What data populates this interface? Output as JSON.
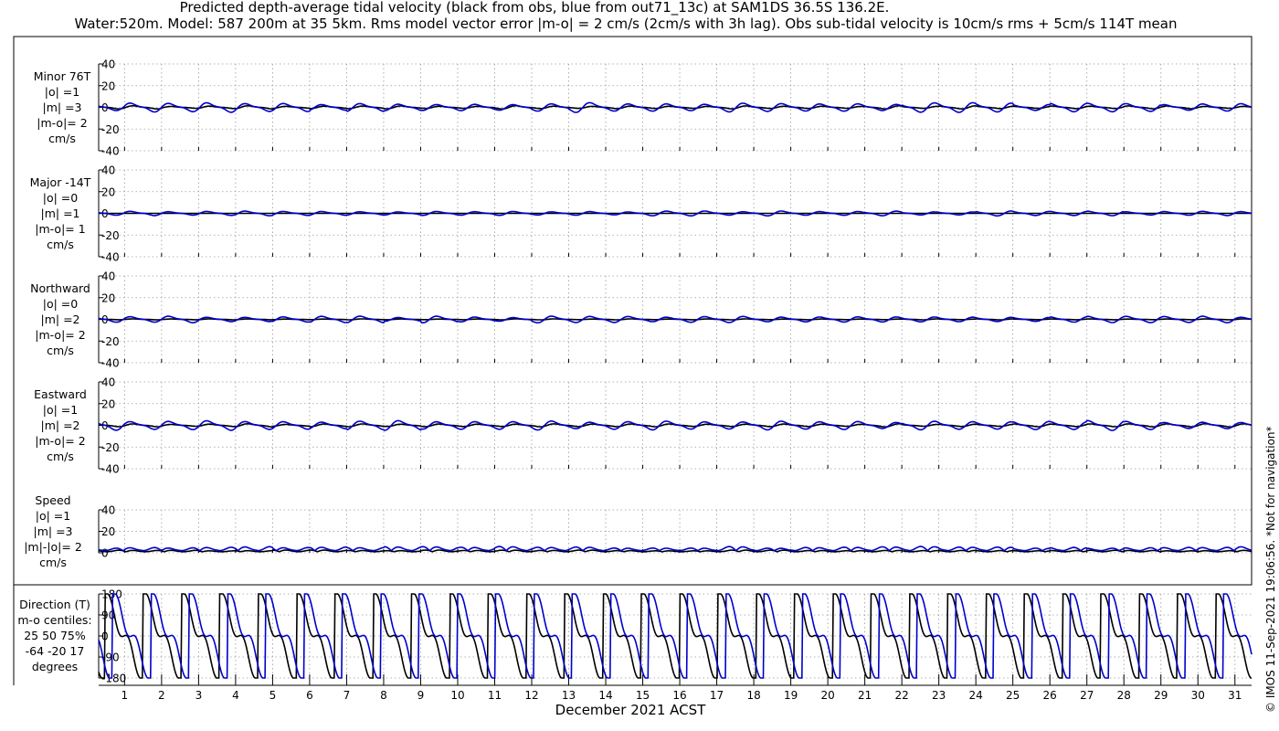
{
  "header": {
    "title_line1": "Predicted depth-average tidal velocity (black from obs, blue from out71_13c) at SAM1DS 36.5S 136.2E.",
    "title_line2": "Water:520m. Model: 587 200m at 35 5km. Rms model vector error |m-o| = 2 cm/s (2cm/s with 3h lag). Obs sub-tidal velocity is 10cm/s rms + 5cm/s 114T mean"
  },
  "footer": {
    "xlabel": "December 2021 ACST",
    "copyright": "© IMOS 11-Sep-2021 19:06:56. *Not for navigation*"
  },
  "colors": {
    "obs": "#000000",
    "model": "#0000cc",
    "grid": "#9a9a9a"
  },
  "panels": [
    {
      "id": "minor",
      "label_lines": [
        "Minor 76T",
        "|o| =1",
        "|m| =3",
        "|m-o|= 2",
        "cm/s"
      ]
    },
    {
      "id": "major",
      "label_lines": [
        "Major -14T",
        "|o| =0",
        "|m| =1",
        "|m-o|= 1",
        "cm/s"
      ]
    },
    {
      "id": "north",
      "label_lines": [
        "Northward",
        "|o| =0",
        "|m| =2",
        "|m-o|= 2",
        "cm/s"
      ]
    },
    {
      "id": "east",
      "label_lines": [
        "Eastward",
        "|o| =1",
        "|m| =2",
        "|m-o|= 2",
        "cm/s"
      ]
    },
    {
      "id": "speed",
      "label_lines": [
        "Speed",
        "|o| =1",
        "|m| =3",
        "|m|-|o|= 2",
        "cm/s"
      ]
    },
    {
      "id": "direction",
      "label_lines": [
        "Direction (T)",
        "m-o centiles:",
        "25  50  75%",
        "-64 -20  17",
        "degrees"
      ]
    }
  ],
  "chart_data": [
    {
      "id": "minor",
      "type": "line",
      "ylabel": "Minor 76T (cm/s)",
      "ylim": [
        -40,
        40
      ],
      "yticks": [
        -40,
        -20,
        0,
        20,
        40
      ],
      "xlim": [
        0.3,
        31.45
      ],
      "xticks": [
        1,
        2,
        3,
        4,
        5,
        6,
        7,
        8,
        9,
        10,
        11,
        12,
        13,
        14,
        15,
        16,
        17,
        18,
        19,
        20,
        21,
        22,
        23,
        24,
        25,
        26,
        27,
        28,
        29,
        30,
        31
      ],
      "grid": true,
      "series": [
        {
          "name": "obs",
          "color": "#000000",
          "amplitude": 1,
          "offset": 0
        },
        {
          "name": "model",
          "color": "#0000cc",
          "amplitude": 3,
          "offset": 0
        }
      ]
    },
    {
      "id": "major",
      "type": "line",
      "ylabel": "Major -14T (cm/s)",
      "ylim": [
        -40,
        40
      ],
      "yticks": [
        -40,
        -20,
        0,
        20,
        40
      ],
      "xlim": [
        0.3,
        31.45
      ],
      "grid": true,
      "series": [
        {
          "name": "obs",
          "color": "#000000",
          "amplitude": 0,
          "offset": 0
        },
        {
          "name": "model",
          "color": "#0000cc",
          "amplitude": 1.5,
          "offset": 0
        }
      ]
    },
    {
      "id": "north",
      "type": "line",
      "ylabel": "Northward (cm/s)",
      "ylim": [
        -40,
        40
      ],
      "yticks": [
        -40,
        -20,
        0,
        20,
        40
      ],
      "xlim": [
        0.3,
        31.45
      ],
      "grid": true,
      "series": [
        {
          "name": "obs",
          "color": "#000000",
          "amplitude": 0.3,
          "offset": 0
        },
        {
          "name": "model",
          "color": "#0000cc",
          "amplitude": 2,
          "offset": 0
        }
      ]
    },
    {
      "id": "east",
      "type": "line",
      "ylabel": "Eastward (cm/s)",
      "ylim": [
        -40,
        40
      ],
      "yticks": [
        -40,
        -20,
        0,
        20,
        40
      ],
      "xlim": [
        0.3,
        31.45
      ],
      "grid": true,
      "series": [
        {
          "name": "obs",
          "color": "#000000",
          "amplitude": 1,
          "offset": 0
        },
        {
          "name": "model",
          "color": "#0000cc",
          "amplitude": 3,
          "offset": 0
        }
      ]
    },
    {
      "id": "speed",
      "type": "line",
      "ylabel": "Speed (cm/s)",
      "ylim": [
        0,
        40
      ],
      "yticks": [
        0,
        20,
        40
      ],
      "xlim": [
        0.3,
        31.45
      ],
      "grid": true,
      "series": [
        {
          "name": "obs",
          "color": "#000000",
          "amplitude": 1,
          "offset": 1
        },
        {
          "name": "model",
          "color": "#0000cc",
          "amplitude": 2.5,
          "offset": 2
        }
      ]
    },
    {
      "id": "direction",
      "type": "line",
      "ylabel": "Direction (T) (degrees)",
      "ylim": [
        -180,
        180
      ],
      "yticks": [
        -180,
        -90,
        0,
        90,
        180
      ],
      "xlim": [
        0.3,
        31.45
      ],
      "grid": true,
      "series": [
        {
          "name": "obs",
          "color": "#000000",
          "period_days": 1.035,
          "phase": 0.55
        },
        {
          "name": "model",
          "color": "#0000cc",
          "period_days": 1.035,
          "phase": 0.35
        }
      ]
    }
  ]
}
